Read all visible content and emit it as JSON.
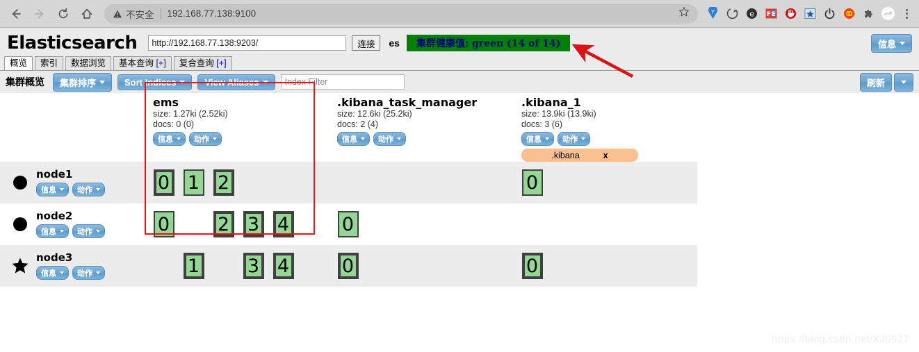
{
  "browser": {
    "back_icon": "back-arrow-icon",
    "forward_icon": "forward-arrow-icon",
    "reload_icon": "reload-icon",
    "home_icon": "home-icon",
    "security_warning": "不安全",
    "url": "192.168.77.138:9100",
    "bookmark_icon": "star-icon",
    "menu_icon": "kebab-menu-icon",
    "extensions": [
      {
        "name": "yandex-extension-icon",
        "glyph": "Y",
        "color": "#1a73e8"
      },
      {
        "name": "sync-extension-icon",
        "glyph": "↻",
        "color": "#4a4a4a"
      },
      {
        "name": "evernote-extension-icon",
        "glyph": "e",
        "color": "#2d2d2d"
      },
      {
        "name": "feedly-extension-icon",
        "glyph": "FE",
        "color": "#e8392f"
      },
      {
        "name": "adblock-extension-icon",
        "glyph": "✋",
        "color": "#d40000"
      },
      {
        "name": "bookmark-star-extension-icon",
        "glyph": "★",
        "color": "#2a5d8f"
      },
      {
        "name": "power-extension-icon",
        "glyph": "⏻",
        "color": "#3a3a3a"
      },
      {
        "name": "infinity-extension-icon",
        "glyph": "∞",
        "color": "#ff3d00"
      },
      {
        "name": "puzzle-extension-icon",
        "glyph": "❖",
        "color": "#5a5a5a"
      },
      {
        "name": "profile-avatar-icon",
        "glyph": "◑",
        "color": "#9a9a9a"
      }
    ]
  },
  "app": {
    "title": "Elasticsearch",
    "host_value": "http://192.168.77.138:9203/",
    "connect_label": "连接",
    "cluster_name": "es",
    "health_text": "集群健康值: green (14 of 14)",
    "health_color": "#008000",
    "info_label": "信息",
    "tabs": [
      {
        "label": "概览",
        "active": true,
        "plus": ""
      },
      {
        "label": "索引",
        "active": false,
        "plus": ""
      },
      {
        "label": "数据浏览",
        "active": false,
        "plus": ""
      },
      {
        "label": "基本查询",
        "active": false,
        "plus": "[+]"
      },
      {
        "label": "复合查询",
        "active": false,
        "plus": "[+]"
      }
    ],
    "toolbar": {
      "title": "集群概览",
      "sort_cluster_label": "集群排序",
      "sort_indices_label": "Sort Indices",
      "view_aliases_label": "View Aliases",
      "filter_placeholder": "Index Filter",
      "filter_value": "",
      "refresh_label": "刷新"
    }
  },
  "buttons": {
    "info": "信息",
    "action": "动作"
  },
  "indices": [
    {
      "name": "ems",
      "size": "size: 1.27ki (2.52ki)",
      "docs": "docs: 0 (0)",
      "alias": null
    },
    {
      "name": ".kibana_task_manager",
      "size": "size: 12.6ki (25.2ki)",
      "docs": "docs: 2 (4)",
      "alias": null
    },
    {
      "name": ".kibana_1",
      "size": "size: 13.9ki (13.9ki)",
      "docs": "docs: 3 (6)",
      "alias": {
        "label": ".kibana",
        "close": "x"
      }
    }
  ],
  "nodes": [
    {
      "name": "node1",
      "marker": "circle-icon",
      "shards": {
        "ems": [
          {
            "num": "0",
            "type": "primary"
          },
          {
            "num": "1",
            "type": "replica"
          },
          {
            "num": "2",
            "type": "primary"
          },
          null,
          null
        ],
        ".kibana_task_manager": [
          null
        ],
        ".kibana_1": [
          {
            "num": "0",
            "type": "replica"
          }
        ]
      }
    },
    {
      "name": "node2",
      "marker": "circle-icon",
      "shards": {
        "ems": [
          {
            "num": "0",
            "type": "replica"
          },
          null,
          {
            "num": "2",
            "type": "primary"
          },
          {
            "num": "3",
            "type": "primary"
          },
          {
            "num": "4",
            "type": "primary"
          }
        ],
        ".kibana_task_manager": [
          {
            "num": "0",
            "type": "replica"
          }
        ],
        ".kibana_1": [
          null
        ]
      }
    },
    {
      "name": "node3",
      "marker": "star-icon",
      "shards": {
        "ems": [
          null,
          {
            "num": "1",
            "type": "primary"
          },
          null,
          {
            "num": "3",
            "type": "primary"
          },
          {
            "num": "4",
            "type": "primary"
          }
        ],
        ".kibana_task_manager": [
          {
            "num": "0",
            "type": "primary"
          }
        ],
        ".kibana_1": [
          {
            "num": "0",
            "type": "primary"
          }
        ]
      }
    }
  ],
  "annotations": {
    "highlight_color": "#ee1111",
    "arrow_color": "#dd1111"
  },
  "watermark": "https://blog.csdn.net/XJ0927"
}
